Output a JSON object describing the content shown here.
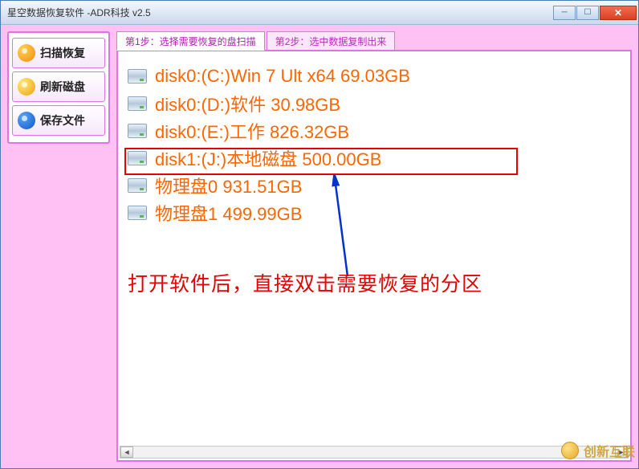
{
  "window": {
    "title": "星空数据恢复软件  -ADR科技 v2.5"
  },
  "sidebar": {
    "scan_label": "扫描恢复",
    "refresh_label": "刷新磁盘",
    "save_label": "保存文件"
  },
  "tabs": {
    "step1": "第1步：选择需要恢复的盘扫描",
    "step2": "第2步：选中数据复制出来"
  },
  "disks": [
    {
      "label": "disk0:(C:)Win 7 Ult x64 69.03GB"
    },
    {
      "label": "disk0:(D:)软件 30.98GB"
    },
    {
      "label": "disk0:(E:)工作 826.32GB"
    },
    {
      "label": "disk1:(J:)本地磁盘 500.00GB"
    },
    {
      "label": "物理盘0 931.51GB"
    },
    {
      "label": "物理盘1 499.99GB"
    }
  ],
  "annotation": "打开软件后，直接双击需要恢复的分区",
  "watermark": "创新互联"
}
